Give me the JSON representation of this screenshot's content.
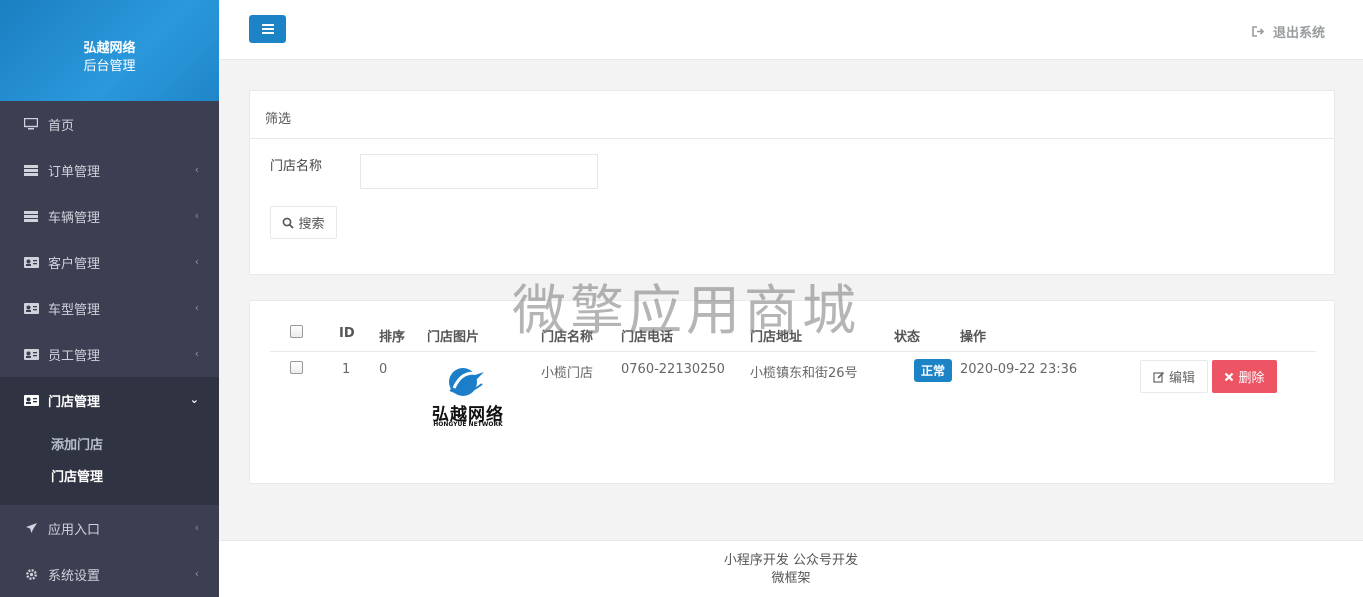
{
  "brand": {
    "line1": "弘越网络",
    "line2": "后台管理"
  },
  "sidebar": {
    "items": [
      {
        "label": "首页",
        "icon": "monitor-icon",
        "has_chevron": false
      },
      {
        "label": "订单管理",
        "icon": "server-icon",
        "has_chevron": true
      },
      {
        "label": "车辆管理",
        "icon": "server-icon",
        "has_chevron": true
      },
      {
        "label": "客户管理",
        "icon": "id-card-icon",
        "has_chevron": true
      },
      {
        "label": "车型管理",
        "icon": "id-card-icon",
        "has_chevron": true
      },
      {
        "label": "员工管理",
        "icon": "id-card-icon",
        "has_chevron": true
      },
      {
        "label": "门店管理",
        "icon": "id-card-icon",
        "has_chevron": true,
        "expanded": true
      },
      {
        "label": "应用入口",
        "icon": "plane-icon",
        "has_chevron": true
      },
      {
        "label": "系统设置",
        "icon": "gear-icon",
        "has_chevron": true
      }
    ],
    "submenu": [
      {
        "label": "添加门店"
      },
      {
        "label": "门店管理",
        "current": true
      }
    ]
  },
  "topbar": {
    "logout_label": "退出系统"
  },
  "filter": {
    "title": "筛选",
    "store_name_label": "门店名称",
    "store_name_value": "",
    "search_label": "搜索"
  },
  "table": {
    "headers": [
      "ID",
      "排序",
      "门店图片",
      "门店名称",
      "门店电话",
      "门店地址",
      "状态",
      "操作"
    ],
    "rows": [
      {
        "id": "1",
        "sort": "0",
        "name": "小榄门店",
        "phone": "0760-22130250",
        "address": "小榄镇东和街26号",
        "status": "正常",
        "time": "2020-09-22 23:36",
        "edit_label": "编辑",
        "delete_label": "删除",
        "logo_text": "弘越网络",
        "logo_sub": "HONGYUE NETWORK"
      }
    ]
  },
  "watermark": "微擎应用商城",
  "footer": {
    "line1": "小程序开发 公众号开发",
    "line2": "微框架"
  },
  "colors": {
    "primary": "#1c84c6",
    "danger": "#ed5565",
    "sidebar": "#3b3f51"
  }
}
